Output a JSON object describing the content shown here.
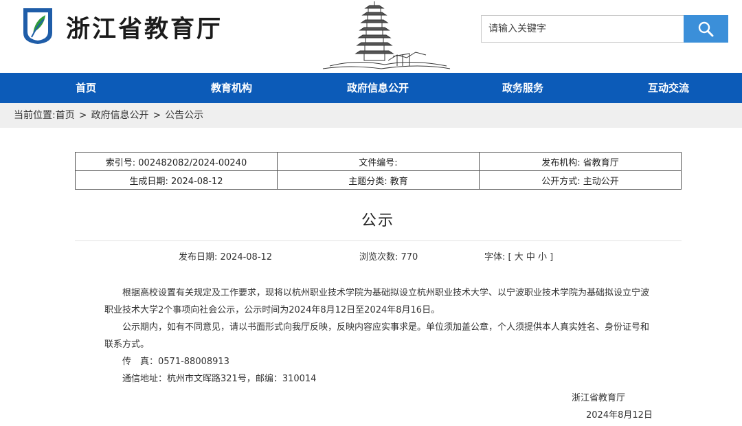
{
  "header": {
    "site_name": "浙江省教育厅",
    "search_placeholder": "请输入关键字"
  },
  "nav": {
    "items": [
      "首页",
      "教育机构",
      "政府信息公开",
      "政务服务",
      "互动交流"
    ]
  },
  "breadcrumb": {
    "prefix": "当前位置:",
    "items": [
      "首页",
      "政府信息公开",
      "公告公示"
    ],
    "separator": ">"
  },
  "meta_table": {
    "rows": [
      [
        "索引号: 002482082/2024-00240",
        "文件编号:",
        "发布机构: 省教育厅"
      ],
      [
        "生成日期: 2024-08-12",
        "主题分类: 教育",
        "公开方式: 主动公开"
      ]
    ]
  },
  "article": {
    "title": "公示",
    "publish_date": "发布日期: 2024-08-12",
    "views": "浏览次数: 770",
    "font_size_label": "字体: [ 大 中 小 ]",
    "paragraphs": [
      "根据高校设置有关规定及工作要求，现将以杭州职业技术学院为基础拟设立杭州职业技术大学、以宁波职业技术学院为基础拟设立宁波职业技术大学2个事项向社会公示，公示时间为2024年8月12日至2024年8月16日。",
      "公示期内，如有不同意见，请以书面形式向我厅反映，反映内容应实事求是。单位须加盖公章，个人须提供本人真实姓名、身份证号和联系方式。",
      "传　真：0571-88008913",
      "通信地址：杭州市文晖路321号，邮编：310014"
    ],
    "signature_org": "浙江省教育厅",
    "signature_date": "2024年8月12日"
  },
  "colors": {
    "nav_bg": "#0c5bb8",
    "search_button": "#3b8fd9",
    "breadcrumb_bg": "#efefef"
  },
  "icons": {
    "logo": "education-dept-logo",
    "search": "search-icon",
    "banner": "pagoda-illustration"
  }
}
